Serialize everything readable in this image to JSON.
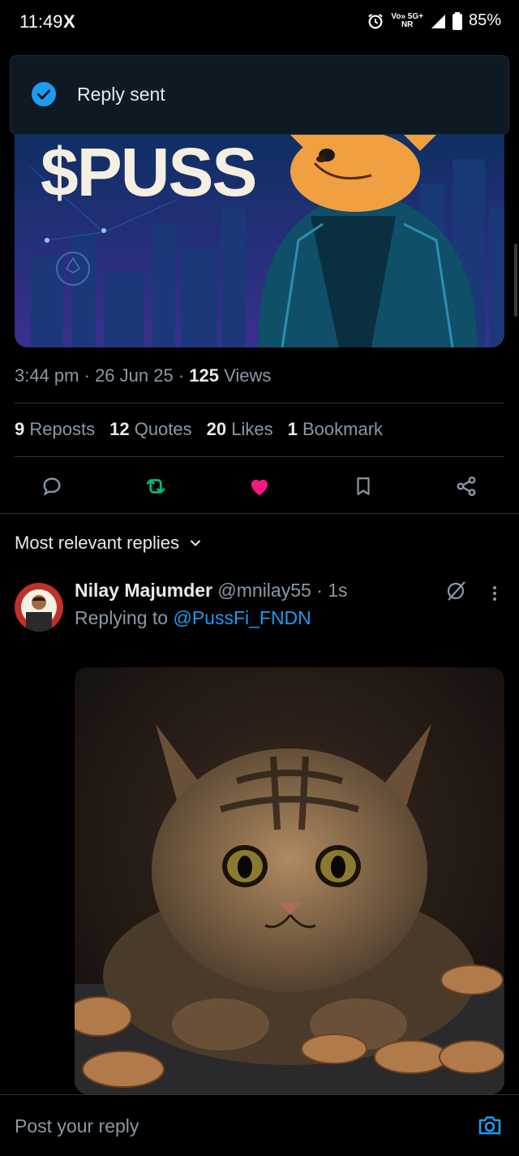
{
  "status_bar": {
    "time": "11:49",
    "x_logo": "X",
    "network_top": "Vo» 5G+",
    "network_bottom": "NR",
    "battery": "85%"
  },
  "toast": {
    "text": "Reply sent"
  },
  "post": {
    "banner_title": "$PUSS",
    "time": "3:44 pm",
    "date": "26 Jun 25",
    "views_count": "125",
    "views_label": "Views",
    "reposts_count": "9",
    "reposts_label": "Reposts",
    "quotes_count": "12",
    "quotes_label": "Quotes",
    "likes_count": "20",
    "likes_label": "Likes",
    "bookmarks_count": "1",
    "bookmarks_label": "Bookmark"
  },
  "replies_filter": {
    "label": "Most relevant replies"
  },
  "reply": {
    "name": "Nilay Majumder",
    "handle": "@mnilay55",
    "age": "1s",
    "replying_prefix": "Replying to",
    "replying_to": "@PussFi_FNDN"
  },
  "composer": {
    "placeholder": "Post your reply"
  },
  "colors": {
    "accent": "#1d9bf0",
    "like": "#f91880",
    "repost": "#00ba7c"
  }
}
